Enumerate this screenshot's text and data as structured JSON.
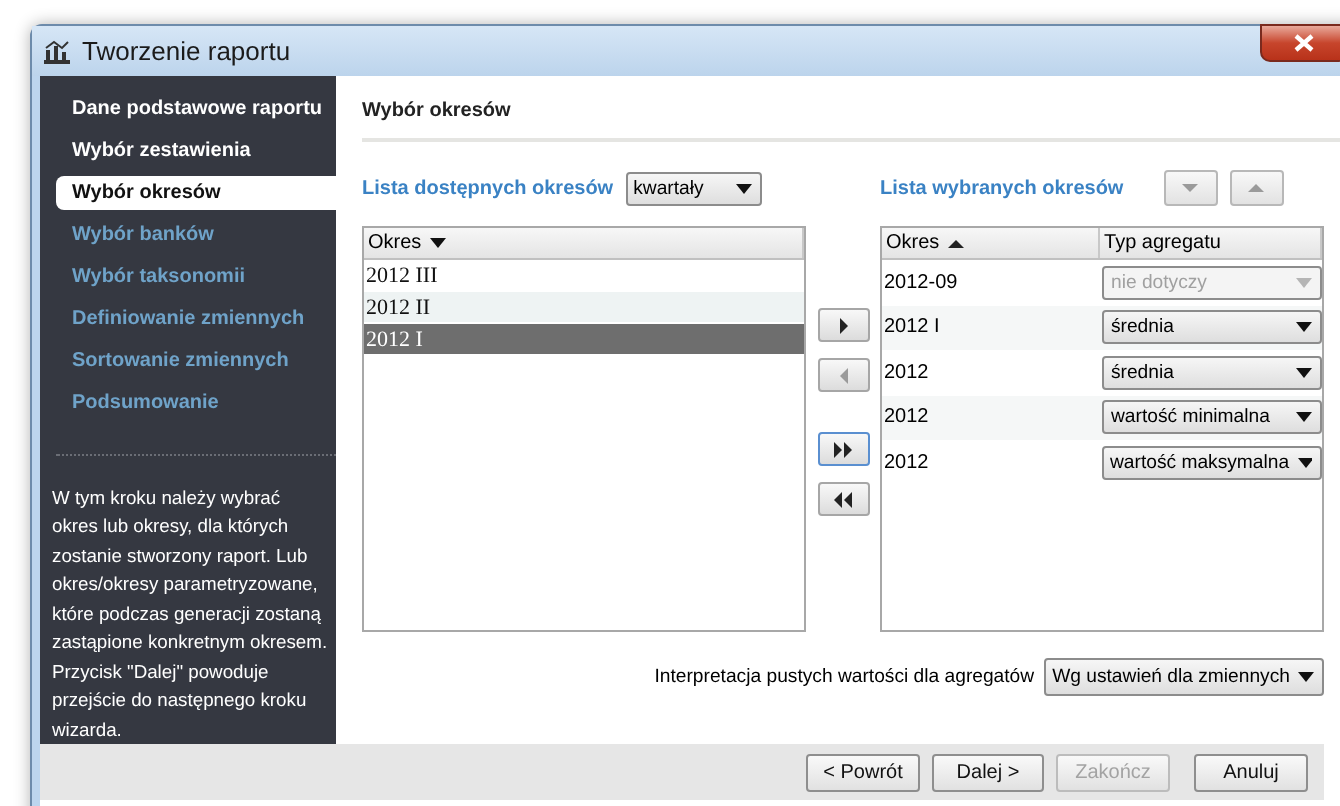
{
  "window": {
    "title": "Tworzenie raportu"
  },
  "sidebar": {
    "items": [
      {
        "label": "Dane podstawowe raportu",
        "selected": false,
        "available": true
      },
      {
        "label": "Wybór zestawienia",
        "selected": false,
        "available": true
      },
      {
        "label": "Wybór okresów",
        "selected": true,
        "available": true
      },
      {
        "label": "Wybór banków",
        "selected": false,
        "available": false
      },
      {
        "label": "Wybór taksonomii",
        "selected": false,
        "available": false
      },
      {
        "label": "Definiowanie zmiennych",
        "selected": false,
        "available": false
      },
      {
        "label": "Sortowanie zmiennych",
        "selected": false,
        "available": false
      },
      {
        "label": "Podsumowanie",
        "selected": false,
        "available": false
      }
    ],
    "description": "W tym kroku należy wybrać okres lub okresy, dla których zostanie stworzony raport. Lub okres/okresy parametryzowane, które podczas generacji zostaną zastąpione konkretnym okresem. Przycisk \"Dalej\" powoduje przejście do następnego kroku wizarda."
  },
  "section_title": "Wybór okresów",
  "available_list": {
    "label": "Lista dostępnych okresów",
    "filter": "kwartały",
    "column": "Okres",
    "rows": [
      {
        "period": "2012 III",
        "selected": false
      },
      {
        "period": "2012 II",
        "selected": false
      },
      {
        "period": "2012 I",
        "selected": true
      }
    ]
  },
  "transfer_buttons": [
    {
      "kind": "right",
      "disabled": false
    },
    {
      "kind": "left",
      "disabled": true
    },
    {
      "kind": "all_right",
      "disabled": false
    },
    {
      "kind": "all_left",
      "disabled": false
    }
  ],
  "selected_list": {
    "label": "Lista wybranych okresów",
    "columns": [
      "Okres",
      "Typ agregatu"
    ],
    "rows": [
      {
        "period": "2012-09",
        "aggregate": "nie dotyczy",
        "disabled": true
      },
      {
        "period": "2012 I",
        "aggregate": "średnia",
        "disabled": false
      },
      {
        "period": "2012",
        "aggregate": "średnia",
        "disabled": false
      },
      {
        "period": "2012",
        "aggregate": "wartość minimalna",
        "disabled": false
      },
      {
        "period": "2012",
        "aggregate": "wartość maksymalna",
        "disabled": false
      }
    ]
  },
  "empty_values": {
    "label": "Interpretacja pustych wartości dla agregatów",
    "value": "Wg ustawień dla zmiennych"
  },
  "footer_buttons": [
    {
      "label": "< Powrót",
      "disabled": false
    },
    {
      "label": "Dalej >",
      "disabled": false
    },
    {
      "label": "Zakończ",
      "disabled": true
    },
    {
      "label": "Anuluj",
      "disabled": false
    }
  ]
}
